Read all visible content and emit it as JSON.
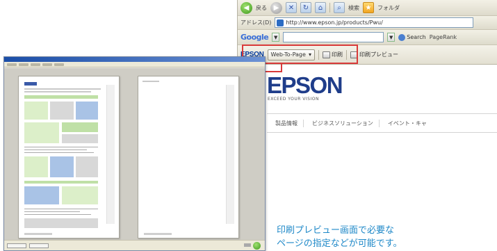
{
  "browser": {
    "nav": {
      "back_label": "戻る",
      "search_label": "検索",
      "favorites_label": "フォルダ"
    },
    "address": {
      "label": "アドレス(D)",
      "url": "http://www.epson.jp/products/Pwu/"
    },
    "google": {
      "logo": "Google",
      "search_label": "Search",
      "pagerank_label": "PageRank"
    },
    "links_toolbar": {
      "brand": "EPSON",
      "dropdown_label": "Web-To-Page",
      "print_label": "印刷",
      "print_preview_label": "印刷プレビュー"
    }
  },
  "page": {
    "logo_text": "EPSON",
    "tagline": "EXCEED YOUR VISION",
    "nav_items": [
      "製品情報",
      "ビジネスソリューション",
      "イベント・キャ"
    ]
  },
  "caption": {
    "line1": "印刷プレビュー画面で必要な",
    "line2": "ページの指定などが可能です。"
  },
  "colors": {
    "highlight": "#d93a3a",
    "caption": "#1e88c8",
    "epson_blue": "#1f3d8a"
  }
}
